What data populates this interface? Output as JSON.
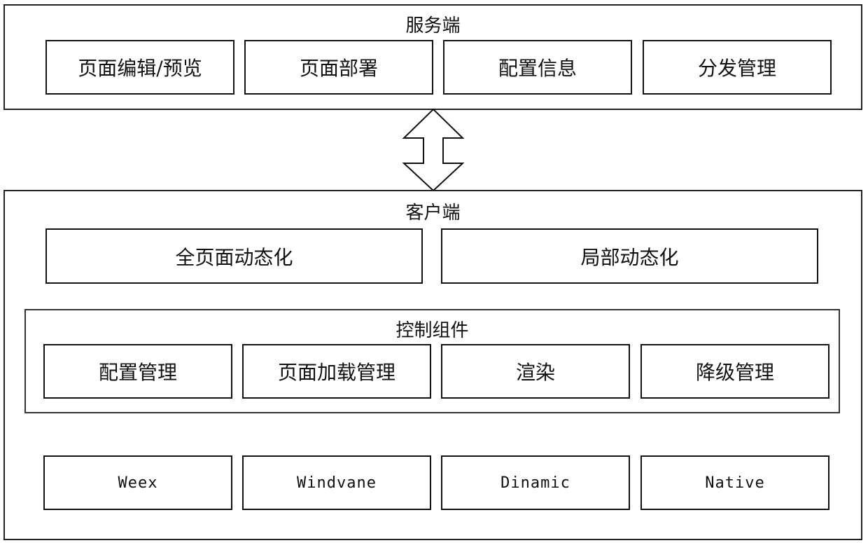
{
  "server": {
    "title": "服务端",
    "modules": [
      {
        "label": "页面编辑/预览"
      },
      {
        "label": "页面部署"
      },
      {
        "label": "配置信息"
      },
      {
        "label": "分发管理"
      }
    ]
  },
  "connector": {
    "icon": "bidirectional-arrow-icon"
  },
  "client": {
    "title": "客户端",
    "modes": [
      {
        "label": "全页面动态化"
      },
      {
        "label": "局部动态化"
      }
    ],
    "control": {
      "title": "控制组件",
      "modules": [
        {
          "label": "配置管理"
        },
        {
          "label": "页面加载管理"
        },
        {
          "label": "渲染"
        },
        {
          "label": "降级管理"
        }
      ]
    },
    "runtimes": [
      {
        "label": "Weex"
      },
      {
        "label": "Windvane"
      },
      {
        "label": "Dinamic"
      },
      {
        "label": "Native"
      }
    ]
  }
}
